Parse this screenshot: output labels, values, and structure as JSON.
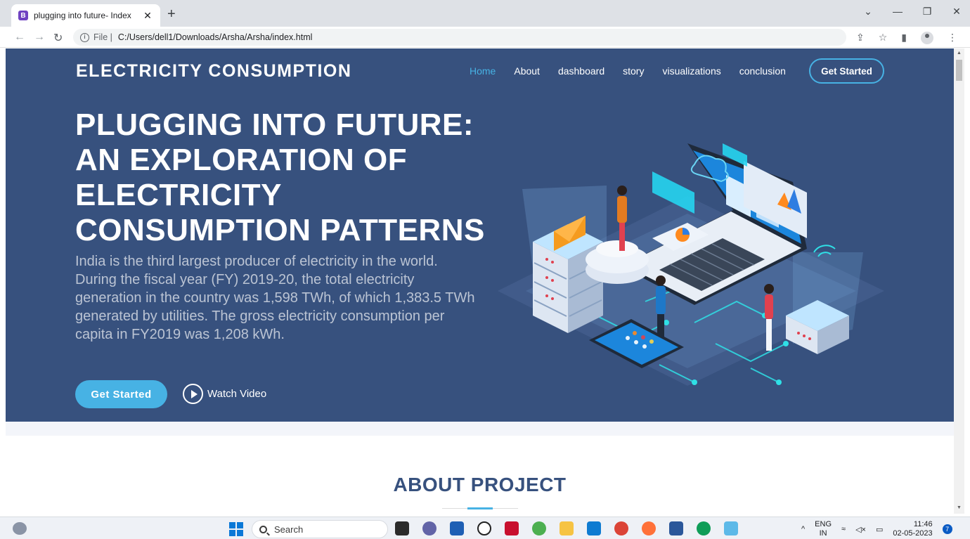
{
  "browser": {
    "tab_title": "plugging into future- Index",
    "favicon_letter": "B",
    "address_prefix": "File",
    "address": "C:/Users/dell1/Downloads/Arsha/Arsha/index.html"
  },
  "page": {
    "logo": "ELECTRICITY CONSUMPTION",
    "nav": {
      "home": "Home",
      "about": "About",
      "dashboard": "dashboard",
      "story": "story",
      "visualizations": "visualizations",
      "conclusion": "conclusion",
      "cta": "Get Started"
    },
    "hero": {
      "title": "PLUGGING INTO FUTURE: AN EXPLORATION OF ELECTRICITY CONSUMPTION PATTERNS",
      "lead": "India is the third largest producer of electricity in the world. During the fiscal year (FY) 2019-20, the total electricity generation in the country was 1,598 TWh, of which 1,383.5 TWh generated by utilities. The gross electricity consumption per capita in FY2019 was 1,208 kWh.",
      "cta": "Get Started",
      "watch": "Watch Video"
    },
    "about_title": "ABOUT PROJECT"
  },
  "taskbar": {
    "search_placeholder": "Search",
    "lang_top": "ENG",
    "lang_bottom": "IN",
    "time": "11:46",
    "date": "02-05-2023",
    "notification_count": "7"
  },
  "colors": {
    "hero_bg": "#37517e",
    "accent": "#47b2e4"
  }
}
